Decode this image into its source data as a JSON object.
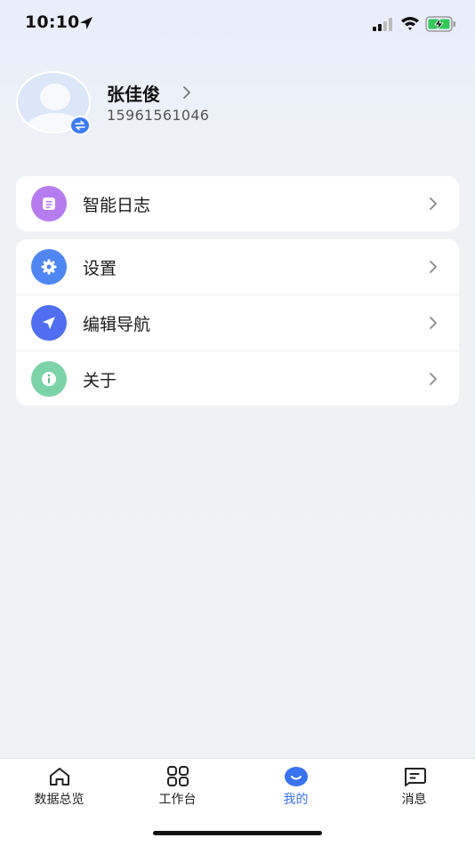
{
  "status_bar": {
    "time": "10:10"
  },
  "profile": {
    "name": "张佳俊",
    "phone": "15961561046"
  },
  "menu_group_1": [
    {
      "label": "智能日志",
      "icon": "notebook-icon",
      "color": "#b57cf0"
    }
  ],
  "menu_group_2": [
    {
      "label": "设置",
      "icon": "gear-icon",
      "color": "#4f86f3"
    },
    {
      "label": "编辑导航",
      "icon": "navigation-arrow-icon",
      "color": "#4f6ff0"
    },
    {
      "label": "关于",
      "icon": "info-icon",
      "color": "#7dd3a8"
    }
  ],
  "tab_bar": {
    "tabs": [
      {
        "label": "数据总览",
        "icon": "home-icon",
        "active": false
      },
      {
        "label": "工作台",
        "icon": "grid-icon",
        "active": false
      },
      {
        "label": "我的",
        "icon": "smile-icon",
        "active": true
      },
      {
        "label": "消息",
        "icon": "message-icon",
        "active": false
      }
    ],
    "active_color": "#3a73ef"
  }
}
